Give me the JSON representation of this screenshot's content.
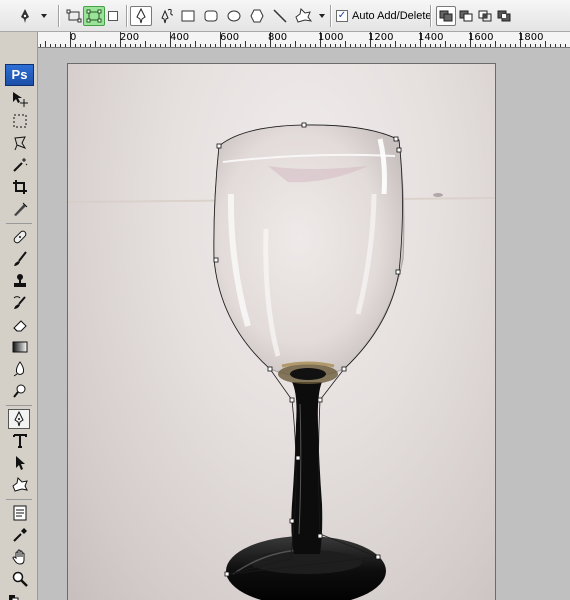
{
  "app": {
    "logo_text": "Ps"
  },
  "options_bar": {
    "auto_add_delete_label": "Auto Add/Delete",
    "auto_add_delete_checked": true,
    "check_mark": "✓"
  },
  "ruler": {
    "labels": [
      "200",
      "0",
      "200",
      "400",
      "600",
      "800",
      "1000",
      "1200",
      "1400",
      "1600",
      "1800"
    ]
  },
  "tools_panel": {
    "grip_text": "»"
  },
  "colors": {
    "path_handle": "#ffffff",
    "selection_green": "#9be39b",
    "logo_blue": "#2e6fd6"
  }
}
